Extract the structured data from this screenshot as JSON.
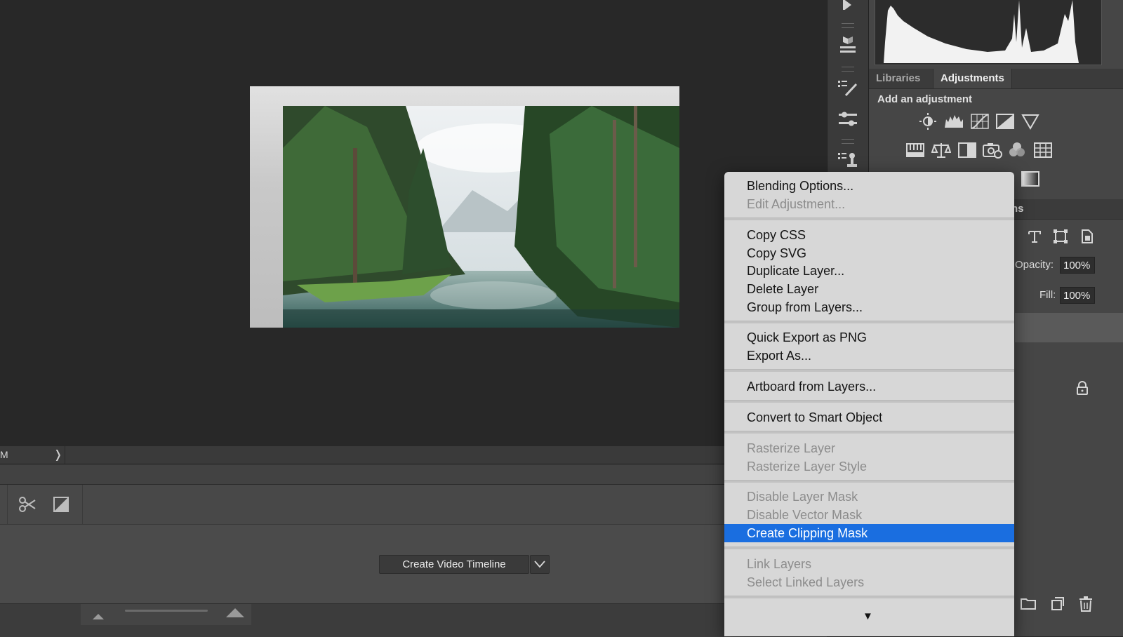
{
  "status_bar": {
    "text": "M",
    "arrow": "chevron-right-icon"
  },
  "timeline": {
    "create_video_label": "Create Video Timeline",
    "dropdown_icon": "chevron-down-icon",
    "tools": [
      "scissors-icon",
      "transition-icon"
    ],
    "zoom_icons": [
      "zoom-out-mountain-icon",
      "zoom-in-mountain-icon"
    ]
  },
  "right_panel": {
    "tabs": [
      {
        "label": "Libraries",
        "active": false
      },
      {
        "label": "Adjustments",
        "active": true
      }
    ],
    "adjustments_title": "Add an adjustment",
    "adjustment_icons_row1": [
      "brightness-contrast-icon",
      "levels-icon",
      "curves-icon",
      "exposure-icon",
      "vibrance-icon"
    ],
    "adjustment_icons_row2": [
      "hue-saturation-icon",
      "color-balance-icon",
      "black-white-icon",
      "photo-filter-icon",
      "channel-mixer-icon",
      "color-lookup-icon"
    ],
    "adjustment_icons_row3": [
      "gradient-map-icon"
    ],
    "layers_tab_fragment": "ns",
    "opacity_label": "Opacity:",
    "opacity_value": "100%",
    "fill_label": "Fill:",
    "fill_value": "100%",
    "layer_filter_icons": [
      "type-filter-icon",
      "transform-filter-icon",
      "smart-object-filter-icon"
    ],
    "lock_icon": "lock-icon",
    "bottom_icons": [
      "folder-icon",
      "new-layer-icon",
      "trash-icon"
    ]
  },
  "context_menu": {
    "items": [
      {
        "label": "Blending Options...",
        "enabled": true
      },
      {
        "label": "Edit Adjustment...",
        "enabled": false
      },
      {
        "label": "Copy CSS",
        "enabled": true
      },
      {
        "label": "Copy SVG",
        "enabled": true
      },
      {
        "label": "Duplicate Layer...",
        "enabled": true
      },
      {
        "label": "Delete Layer",
        "enabled": true
      },
      {
        "label": "Group from Layers...",
        "enabled": true
      },
      {
        "label": "Quick Export as PNG",
        "enabled": true
      },
      {
        "label": "Export As...",
        "enabled": true
      },
      {
        "label": "Artboard from Layers...",
        "enabled": true
      },
      {
        "label": "Convert to Smart Object",
        "enabled": true
      },
      {
        "label": "Rasterize Layer",
        "enabled": false
      },
      {
        "label": "Rasterize Layer Style",
        "enabled": false
      },
      {
        "label": "Disable Layer Mask",
        "enabled": false
      },
      {
        "label": "Disable Vector Mask",
        "enabled": false
      },
      {
        "label": "Create Clipping Mask",
        "enabled": true,
        "highlighted": true
      },
      {
        "label": "Link Layers",
        "enabled": false
      },
      {
        "label": "Select Linked Layers",
        "enabled": false
      }
    ],
    "scroll_indicator": "▼"
  },
  "colors": {
    "app_background": "#282828",
    "menu_background": "#d7d7d7",
    "menu_highlight": "#1a6ee0",
    "panel_background": "#464646"
  }
}
